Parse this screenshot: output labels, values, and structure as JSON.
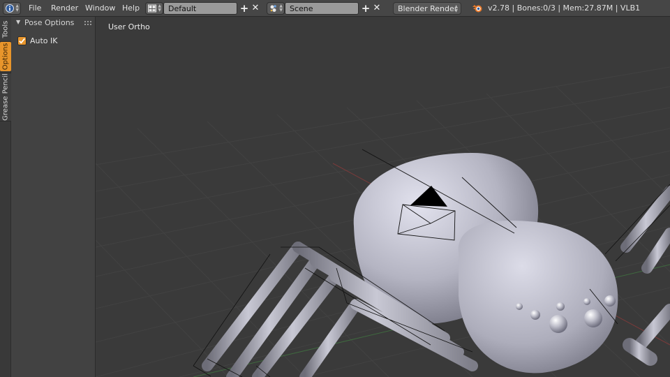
{
  "topbar": {
    "menus": [
      "File",
      "Render",
      "Window",
      "Help"
    ],
    "screen_layout": "Default",
    "scene": "Scene",
    "render_engine": "Blender Render",
    "stats": "v2.78 | Bones:0/3 | Mem:27.87M | VLB1",
    "icons": {
      "info": "info-icon",
      "layout": "screen-layout-icon",
      "scene": "scene-icon",
      "add": "plus-icon",
      "remove": "close-icon",
      "blender": "blender-logo-icon"
    }
  },
  "tabs": [
    "Tools",
    "Options",
    "Grease Pencil"
  ],
  "active_tab": "Options",
  "panel": {
    "title": "Pose Options",
    "options": [
      {
        "label": "Auto IK",
        "checked": true
      }
    ]
  },
  "viewport": {
    "label": "User Ortho"
  },
  "colors": {
    "accent": "#e8952b",
    "header": "#464646",
    "panel": "#424242",
    "viewport_bg": "#3a3a3a",
    "mesh": "#b2b2c0"
  }
}
